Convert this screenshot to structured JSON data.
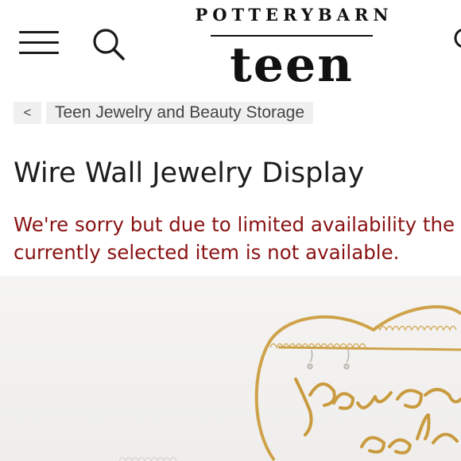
{
  "header": {
    "brand_top": "POTTERYBARN",
    "brand_main": "teen",
    "menu_icon": "hamburger-menu-icon",
    "search_icon": "search-icon",
    "account_icon": "account-icon"
  },
  "breadcrumb": {
    "back_label": "<",
    "category_label": "Teen Jewelry and Beauty Storage"
  },
  "product": {
    "title": "Wire Wall Jewelry Display",
    "notice_line1": "We're sorry but due to limited availability the",
    "notice_line2": "currently selected item is not available.",
    "image_icon": "wire-heart-jewelry-display-image"
  },
  "colors": {
    "notice": "#8a1212",
    "gold_wire": "#cfa24a",
    "crumb_bg": "#f0f0f0"
  }
}
